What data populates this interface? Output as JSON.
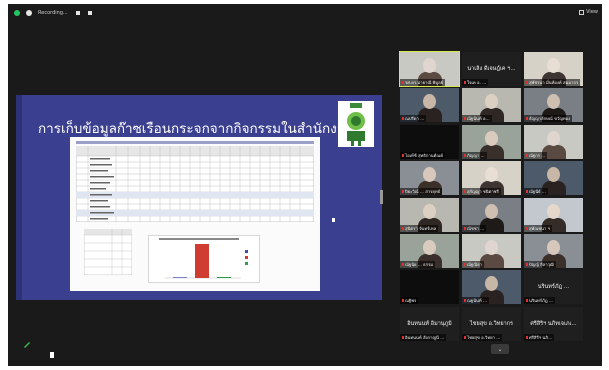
{
  "topbar": {
    "recording_label": "Recording...",
    "view_label": "View"
  },
  "share": {
    "slide_title": "การเก็บข้อมูลก๊าซเรือนกระจกจากกิจกรรมในสำนักงาน"
  },
  "colors": {
    "slide_bg": "#3b3f8f",
    "active_speaker_border": "#d6e84a",
    "bar_green": "#2e9e4a",
    "bar_red": "#d03b32",
    "bar_blue": "#3a4fb0"
  },
  "gallery": {
    "tiles": [
      {
        "name": "รศ.ดร.ม่ายาณี พิบูลย์",
        "type": "video"
      },
      {
        "name": "นาเลิง ดีเจษฎ์เค ฯ...",
        "sub": "ใจเค อ. ...",
        "type": "name"
      },
      {
        "name": "สุพัชรนา มั่นท้องค์ สมมากร",
        "type": "video"
      },
      {
        "name": "ณปรีดา ...",
        "type": "video"
      },
      {
        "name": "ณัฐนันท์ อ...",
        "type": "video"
      },
      {
        "name": "ธัญญาลักษณ์ ขวัญทอง",
        "type": "video"
      },
      {
        "name": "ไอเท้ซ์ สุทธิกานต์ณค์",
        "type": "dark"
      },
      {
        "name": "ภิญญา ...",
        "type": "video"
      },
      {
        "name": "ณัฐกร ...",
        "type": "video"
      },
      {
        "name": "ปิยะวิณ์ ... สารยุทธ์",
        "type": "video"
      },
      {
        "name": "สุกัญญา ชนิตาชรี",
        "type": "video"
      },
      {
        "name": "ณัฐนีย์ ...",
        "type": "video"
      },
      {
        "name": "สุนิตรา จันทร์เหล",
        "type": "video"
      },
      {
        "name": "ณัชชา ...",
        "type": "video"
      },
      {
        "name": "สุพัณชนา ฯ",
        "type": "video"
      },
      {
        "name": "ณัฐนัย ... ธรรม",
        "type": "video"
      },
      {
        "name": "ณัฐณียา",
        "type": "video"
      },
      {
        "name": "ปัญญ์ ลีลาวุฒิ",
        "type": "video"
      },
      {
        "name": "ณฐิพร",
        "type": "dark"
      },
      {
        "name": "ณฐนันท์ ...",
        "type": "video"
      },
      {
        "name": "นรินทร์ภัฎ ...",
        "sub": "นรินทร์ภัฎ ...",
        "type": "name"
      },
      {
        "name": "อินทนนท์ อิมานุภูมิ",
        "sub": "อินทนนท์ สังกาญูนี ...",
        "type": "name"
      },
      {
        "name": "ไชยสุข อ.วิทยากร",
        "sub": "ไชยสุข อ.วิทยา ...",
        "type": "name"
      },
      {
        "name": "ศรีสิริฯ นภิทเจเภเ...",
        "sub": "ศรีสิรีฯ นภิ...",
        "type": "name"
      }
    ]
  },
  "chart_data": {
    "type": "bar",
    "categories": [
      "",
      "",
      ""
    ],
    "values": [
      2,
      100,
      3
    ],
    "colors": [
      "#3a4fb0",
      "#d03b32",
      "#2e9e4a"
    ]
  }
}
